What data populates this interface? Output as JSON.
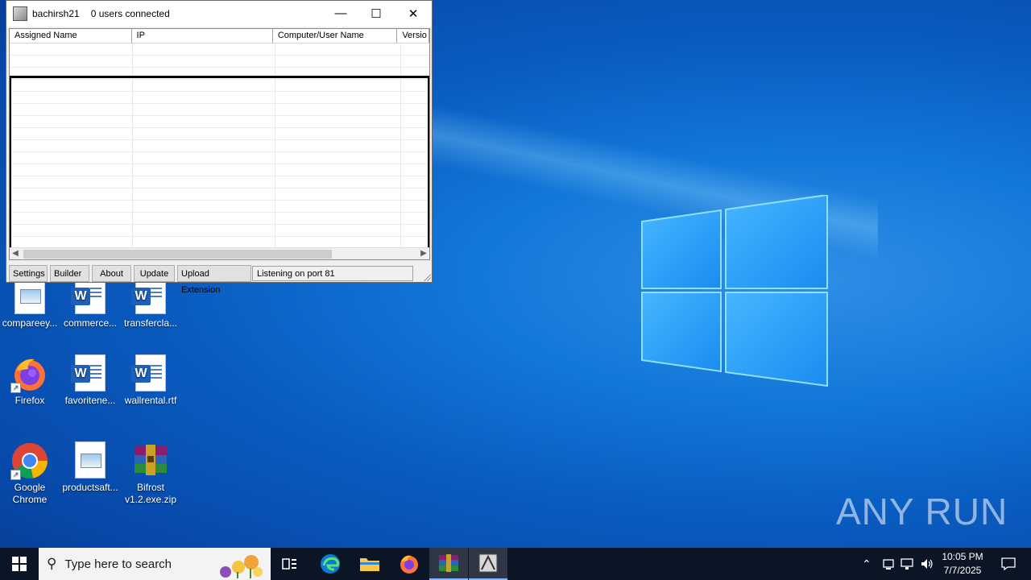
{
  "window": {
    "title": "bachirsh21",
    "status_count": "0 users connected",
    "columns": [
      "Assigned Name",
      "IP",
      "Computer/User Name",
      "Versio"
    ],
    "buttons": [
      "Settings",
      "Builder",
      "About",
      "Update",
      "Upload Extension"
    ],
    "status_text": "Listening on port 81",
    "controls": {
      "minimize": "—",
      "maximize": "☐",
      "close": "✕"
    }
  },
  "desktop": {
    "icons": [
      {
        "label": "compareey...",
        "icon": "image-document-icon"
      },
      {
        "label": "commerce...",
        "icon": "word-document-icon"
      },
      {
        "label": "transfercla...",
        "icon": "word-document-icon"
      },
      {
        "label": "Firefox",
        "icon": "firefox-icon"
      },
      {
        "label": "favoritene...",
        "icon": "word-document-icon"
      },
      {
        "label": "wallrental.rtf",
        "icon": "word-document-icon"
      },
      {
        "label": "Google Chrome",
        "icon": "chrome-icon"
      },
      {
        "label": "productsaft...",
        "icon": "image-document-icon"
      },
      {
        "label": "Bifrost v1.2.exe.zip",
        "icon": "winrar-archive-icon"
      }
    ]
  },
  "watermark": "ANY RUN",
  "taskbar": {
    "search_placeholder": "Type here to search",
    "time": "10:05 PM",
    "date": "7/7/2025"
  }
}
